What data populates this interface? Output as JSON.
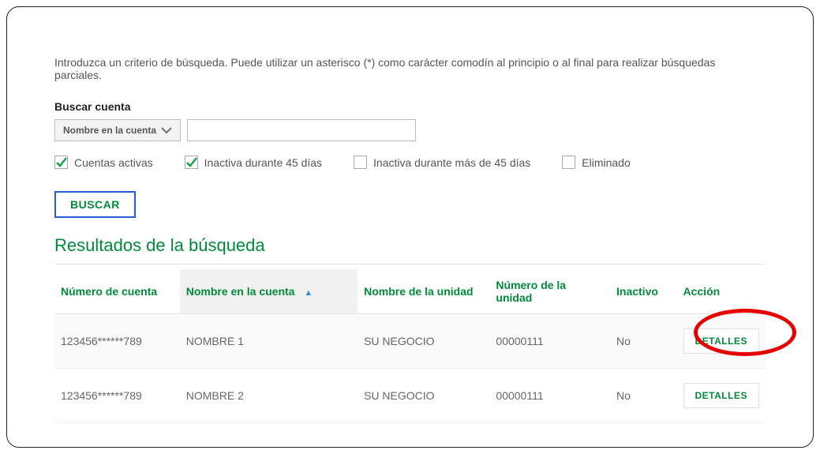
{
  "intro": "Introduzca un criterio de búsqueda. Puede utilizar un asterisco (*) como carácter comodín al principio o al final para realizar búsquedas parciales.",
  "search": {
    "label": "Buscar cuenta",
    "dropdown_selected": "Nombre en la cuenta",
    "input_value": ""
  },
  "filters": {
    "active": {
      "label": "Cuentas activas",
      "checked": true
    },
    "inactive45": {
      "label": "Inactiva durante 45 días",
      "checked": true
    },
    "inactive45plus": {
      "label": "Inactiva durante más de 45 días",
      "checked": false
    },
    "deleted": {
      "label": "Eliminado",
      "checked": false
    }
  },
  "buttons": {
    "search": "BUSCAR",
    "details": "DETALLES"
  },
  "results": {
    "title": "Resultados de la búsqueda",
    "columns": {
      "account_number": "Número de cuenta",
      "account_name": "Nombre en la cuenta",
      "unit_name": "Nombre de la unidad",
      "unit_number": "Número de la unidad",
      "inactive": "Inactivo",
      "action": "Acción"
    },
    "rows": [
      {
        "account_number": "123456******789",
        "account_name": "NOMBRE 1",
        "unit_name": "SU NEGOCIO",
        "unit_number": "00000111",
        "inactive": "No"
      },
      {
        "account_number": "123456******789",
        "account_name": "NOMBRE 2",
        "unit_name": "SU NEGOCIO",
        "unit_number": "00000111",
        "inactive": "No"
      }
    ]
  },
  "colors": {
    "accent_green": "#008a3a",
    "focus_blue": "#2a5bd7",
    "annotation_red": "#e60000"
  }
}
